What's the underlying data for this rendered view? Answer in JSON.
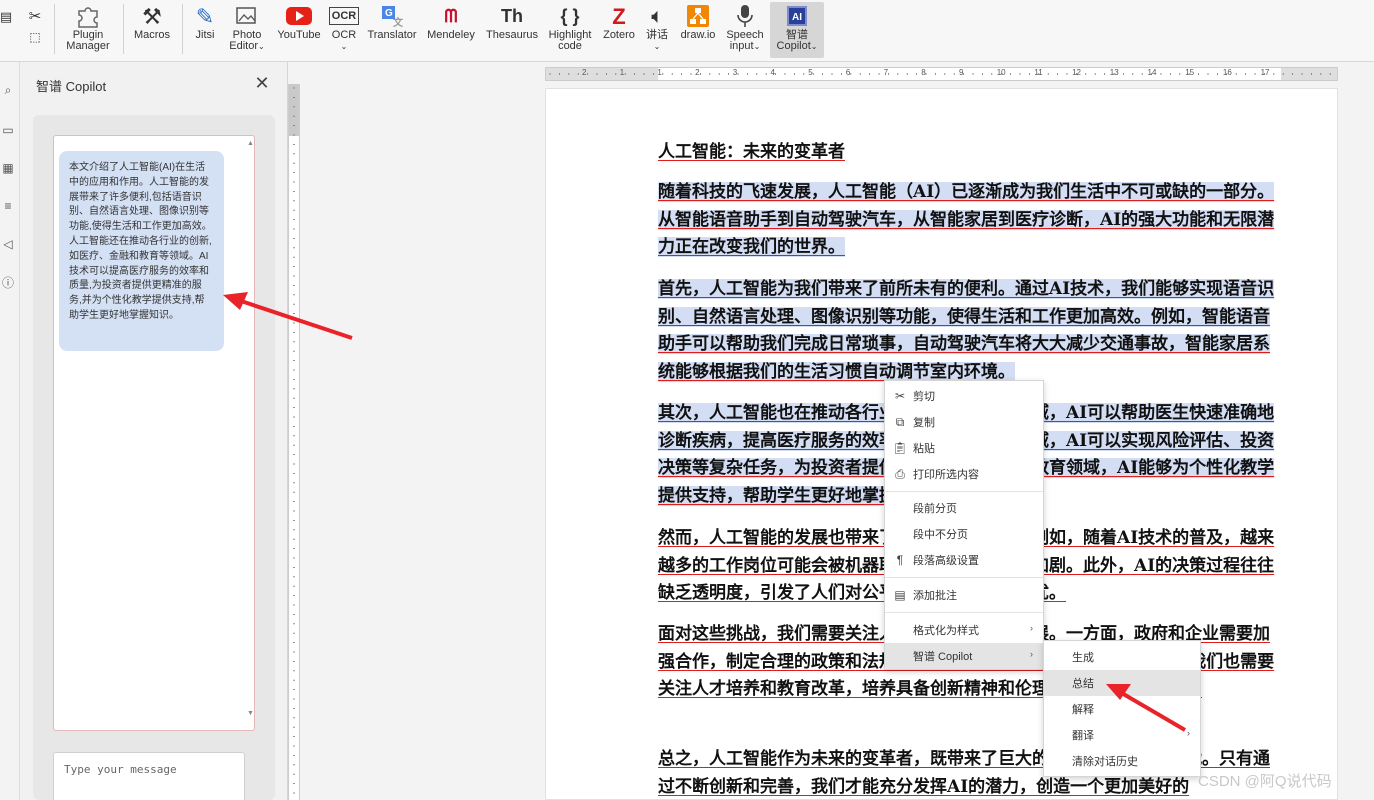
{
  "toolbar": {
    "items": [
      {
        "id": "plugin-manager",
        "label": "Plugin\nManager"
      },
      {
        "id": "macros",
        "label": "Macros"
      },
      {
        "id": "jitsi",
        "label": "Jitsi"
      },
      {
        "id": "photo-editor",
        "label": "Photo\nEditor"
      },
      {
        "id": "youtube",
        "label": "YouTube"
      },
      {
        "id": "ocr",
        "label": "OCR"
      },
      {
        "id": "translator",
        "label": "Translator"
      },
      {
        "id": "mendeley",
        "label": "Mendeley"
      },
      {
        "id": "thesaurus",
        "label": "Thesaurus"
      },
      {
        "id": "highlight-code",
        "label": "Highlight\ncode"
      },
      {
        "id": "zotero",
        "label": "Zotero"
      },
      {
        "id": "speech",
        "label": "讲话"
      },
      {
        "id": "drawio",
        "label": "draw.io"
      },
      {
        "id": "speech-input",
        "label": "Speech\ninput"
      },
      {
        "id": "zhipu-copilot",
        "label": "智谱\nCopilot"
      }
    ],
    "icon_glyphs": {
      "ocr": "OCR",
      "thesaurus": "Th",
      "highlight-code": "{ }",
      "zotero": "Z",
      "zhipu-copilot": "AI"
    }
  },
  "copilot": {
    "title": "智谱 Copilot",
    "summary": "本文介绍了人工智能(AI)在生活中的应用和作用。人工智能的发展带来了许多便利,包括语音识别、自然语言处理、图像识别等功能,使得生活和工作更加高效。人工智能还在推动各行业的创新,如医疗、金融和教育等领域。AI技术可以提高医疗服务的效率和质量,为投资者提供更精准的服务,并为个性化教学提供支持,帮助学生更好地掌握知识。",
    "input_placeholder": "Type your message"
  },
  "ruler": {
    "numbers": [
      "2",
      "1",
      "1",
      "2",
      "3",
      "4",
      "5",
      "6",
      "7",
      "8",
      "9",
      "10",
      "11",
      "12",
      "13",
      "14",
      "15",
      "16",
      "17"
    ]
  },
  "document": {
    "paragraphs": [
      "人工智能：未来的变革者",
      "随着科技的飞速发展，人工智能（AI）已逐渐成为我们生活中不可或缺的一部分。从智能语音助手到自动驾驶汽车，从智能家居到医疗诊断，AI的强大功能和无限潜力正在改变我们的世界。",
      "首先，人工智能为我们带来了前所未有的便利。通过AI技术，我们能够实现语音识别、自然语言处理、图像识别等功能，使得生活和工作更加高效。例如，智能语音助手可以帮助我们完成日常琐事，自动驾驶汽车将大大减少交通事故，智能家居系统能够根据我们的生活习惯自动调节室内环境。",
      "其次，人工智能也在推动各行业的创新。在医疗领域，AI可以帮助医生快速准确地诊断疾病，提高医疗服务的效率和质量。在金融领域，AI可以实现风险评估、投资决策等复杂任务，为投资者提供更精准的服务。在教育领域，AI能够为个性化教学提供支持，帮助学生更好地掌握知识。",
      "然而，人工智能的发展也带来了一些挑战和担忧。例如，随着AI技术的普及，越来越多的工作岗位可能会被机器取代，导致失业问题加剧。此外，AI的决策过程往往缺乏透明度，引发了人们对公平、隐私和伦理的担忧。",
      "面对这些挑战，我们需要关注人工智能的可持续发展。一方面，政府和企业需要加强合作，制定合理的政策和法规，引导AI技术的健康发展。另一方面，我们也需要关注人才培养和教育改革，培养具备创新精神和伦理观念的新一代人才。",
      "总之，人工智能作为未来的变革者，既带来了巨大的机遇，也带来了挑战。只有通过不断创新和完善，我们才能充分发挥AI的潜力，创造一个更加美好的"
    ]
  },
  "context_menu": {
    "items": [
      {
        "label": "剪切",
        "icon": "scissors-icon"
      },
      {
        "label": "复制",
        "icon": "copy-icon"
      },
      {
        "label": "粘贴",
        "icon": "paste-icon"
      },
      {
        "label": "打印所选内容",
        "icon": "print-icon"
      },
      {
        "label": "段前分页",
        "icon": ""
      },
      {
        "label": "段中不分页",
        "icon": ""
      },
      {
        "label": "段落高级设置",
        "icon": "pilcrow-icon"
      },
      {
        "label": "添加批注",
        "icon": "comment-icon"
      },
      {
        "label": "格式化为样式",
        "icon": ""
      },
      {
        "label": "智谱 Copilot",
        "icon": ""
      }
    ],
    "submenu": [
      "生成",
      "总结",
      "解释",
      "翻译",
      "清除对话历史"
    ]
  },
  "watermark": "CSDN @阿Q说代码",
  "colors": {
    "selection": "#d3ddf3",
    "underline": "#e01c1c",
    "arrow": "#e8242a",
    "bubble": "#d4e1f5"
  }
}
